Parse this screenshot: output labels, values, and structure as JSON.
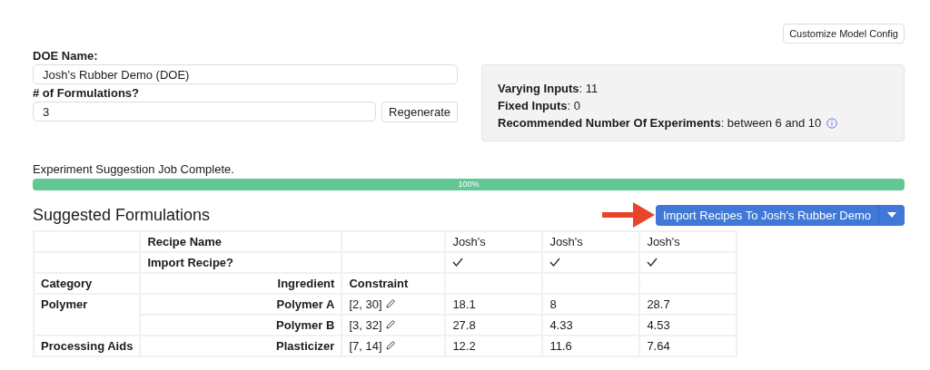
{
  "customize_button": "Customize Model Config",
  "doe_name": {
    "label": "DOE Name:",
    "value": "Josh's Rubber Demo (DOE)"
  },
  "formulations": {
    "label": "# of Formulations?",
    "value": "3",
    "button": "Regenerate"
  },
  "summary": [
    {
      "text": "**Varying Inputs**: 11"
    },
    {
      "text": "**Fixed Inputs**: 0"
    },
    {
      "text": "**Recommended Number Of Experiments**: between 6 and 10",
      "info": true
    }
  ],
  "job": {
    "status": "Experiment Suggestion Job Complete.",
    "level": 1,
    "reading": "100%"
  },
  "heading": "Suggested Formulations",
  "import_button": "Import Recipes To Josh's Rubber Demo",
  "table": {
    "recipe_name_label": "Recipe Name",
    "import_label": "Import Recipe?",
    "recipes": [
      {
        "name": "Josh's",
        "checked": true
      },
      {
        "name": "Josh's",
        "checked": true
      },
      {
        "name": "Josh's",
        "checked": true
      }
    ],
    "columns": [
      "Category",
      "Ingredient",
      "Constraint"
    ],
    "groups": [
      {
        "category": "Polymer",
        "rows": [
          {
            "ingredient": "Polymer A",
            "constraint": "[2, 30]",
            "values": [
              "18.1",
              "8",
              "28.7"
            ]
          },
          {
            "ingredient": "Polymer B",
            "constraint": "[3, 32]",
            "values": [
              "27.8",
              "4.33",
              "4.53"
            ]
          }
        ]
      },
      {
        "category": "Processing Aids",
        "rows": [
          {
            "ingredient": "Plasticizer",
            "constraint": "[7, 14]",
            "values": [
              "12.2",
              "11.6",
              "7.64"
            ]
          }
        ]
      }
    ]
  }
}
